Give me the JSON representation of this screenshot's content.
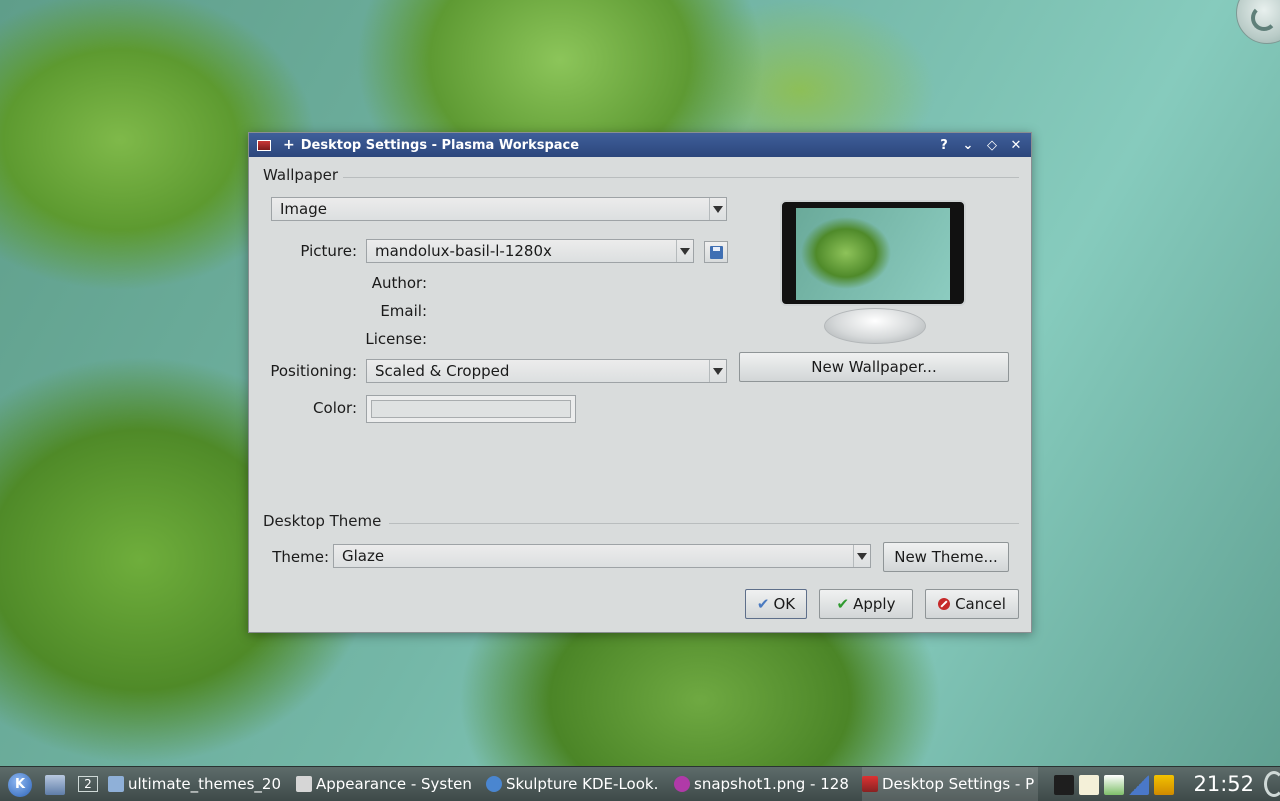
{
  "dialog": {
    "title": "Desktop Settings - Plasma Workspace",
    "pin_symbol": "+",
    "title_buttons": [
      "?",
      "⌄",
      "◇",
      "✕"
    ]
  },
  "wallpaper": {
    "section_label": "Wallpaper",
    "type_value": "Image",
    "picture_label": "Picture:",
    "picture_value": "mandolux-basil-l-1280x",
    "author_label": "Author:",
    "email_label": "Email:",
    "license_label": "License:",
    "positioning_label": "Positioning:",
    "positioning_value": "Scaled & Cropped",
    "color_label": "Color:",
    "new_wallpaper_label": "New Wallpaper..."
  },
  "theme": {
    "section_label": "Desktop Theme",
    "theme_label": "Theme:",
    "theme_value": "Glaze",
    "new_theme_label": "New Theme..."
  },
  "buttons": {
    "ok": "OK",
    "apply": "Apply",
    "cancel": "Cancel"
  },
  "taskbar": {
    "desktop_number": "2",
    "tasks": [
      "ultimate_themes_20",
      "Appearance - Systen",
      "Skulpture KDE-Look.",
      "snapshot1.png - 128",
      "Desktop Settings - P"
    ],
    "clock": "21:52"
  }
}
